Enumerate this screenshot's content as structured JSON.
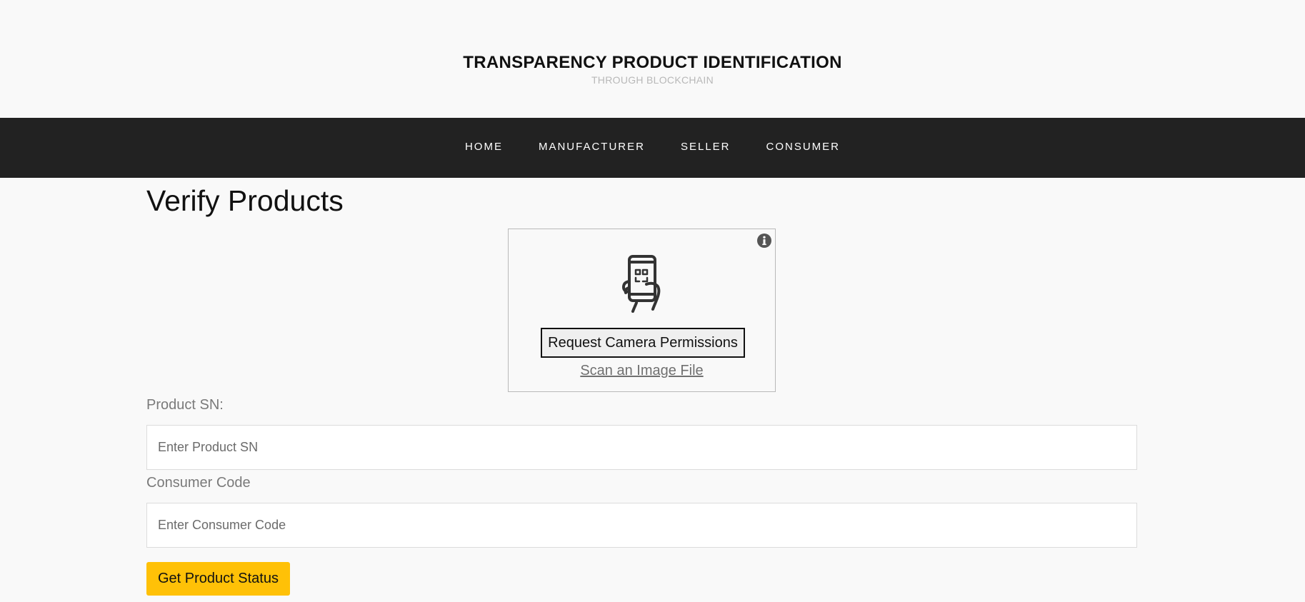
{
  "header": {
    "title": "TRANSPARENCY PRODUCT IDENTIFICATION",
    "subtitle": "THROUGH BLOCKCHAIN"
  },
  "nav": {
    "items": [
      {
        "label": "HOME"
      },
      {
        "label": "MANUFACTURER"
      },
      {
        "label": "SELLER"
      },
      {
        "label": "CONSUMER"
      }
    ]
  },
  "main": {
    "page_title": "Verify Products",
    "scanner": {
      "icon": "phone-qr-scan-icon",
      "info_icon": "info-icon",
      "camera_button_label": "Request Camera Permissions",
      "scan_file_link": "Scan an Image File"
    },
    "form": {
      "product_sn_label": "Product SN:",
      "product_sn_placeholder": "Enter Product SN",
      "product_sn_value": "",
      "consumer_code_label": "Consumer Code",
      "consumer_code_placeholder": "Enter Consumer Code",
      "consumer_code_value": "",
      "submit_label": "Get Product Status"
    }
  },
  "colors": {
    "background": "#f9f9f9",
    "navbar": "#222222",
    "accent_button": "#ffc107",
    "subtitle": "#b8b8b8"
  }
}
